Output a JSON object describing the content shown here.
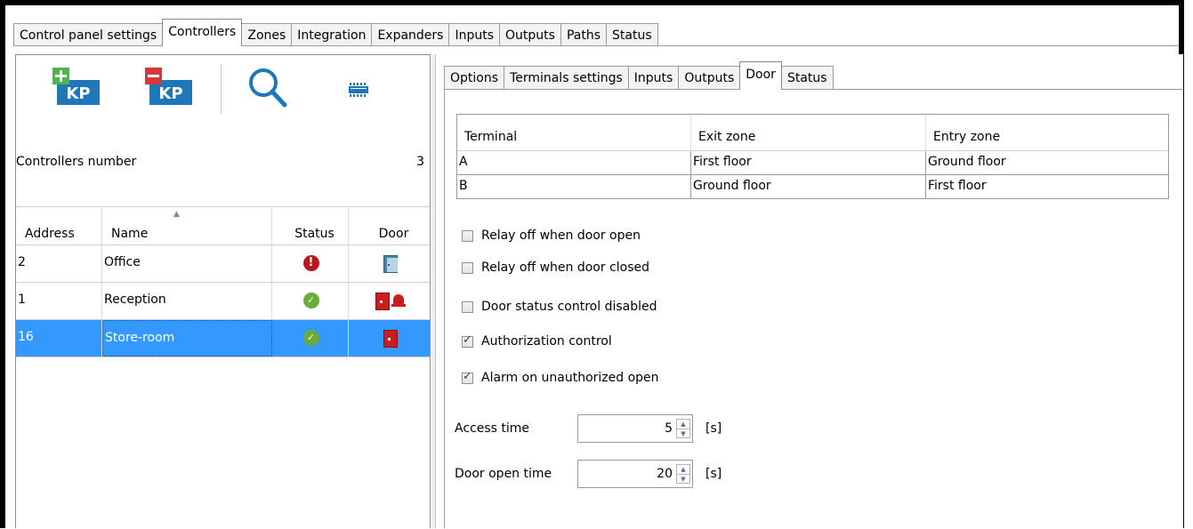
{
  "main_tabs": [
    "Control panel settings",
    "Controllers",
    "Zones",
    "Integration",
    "Expanders",
    "Inputs",
    "Outputs",
    "Paths",
    "Status"
  ],
  "main_active_tab": "Controllers",
  "toolbar": {
    "add_icon_text": "KP",
    "remove_icon_text": "KP"
  },
  "controllers_number": {
    "label": "Controllers number",
    "value": "3"
  },
  "controllers_table": {
    "headers": [
      "Address",
      "Name",
      "Status",
      "Door"
    ],
    "rows": [
      {
        "address": "2",
        "name": "Office",
        "status": "error",
        "door": "closed"
      },
      {
        "address": "1",
        "name": "Reception",
        "status": "ok",
        "door": "open-alarm"
      },
      {
        "address": "16",
        "name": "Store-room",
        "status": "ok",
        "door": "open",
        "selected": true
      }
    ]
  },
  "detail_tabs": [
    "Options",
    "Terminals settings",
    "Inputs",
    "Outputs",
    "Door",
    "Status"
  ],
  "detail_active_tab": "Door",
  "terminals_table": {
    "headers": [
      "Terminal",
      "Exit zone",
      "Entry zone"
    ],
    "rows": [
      [
        "A",
        "First floor",
        "Ground floor"
      ],
      [
        "B",
        "Ground floor",
        "First floor"
      ]
    ]
  },
  "options": [
    {
      "label": "Relay off when door open",
      "checked": false
    },
    {
      "label": "Relay off when door closed",
      "checked": false
    },
    {
      "label": "Door status control disabled",
      "checked": false
    },
    {
      "label": "Authorization control",
      "checked": true
    },
    {
      "label": "Alarm on unauthorized open",
      "checked": true
    }
  ],
  "access_time": {
    "label": "Access time",
    "value": "5",
    "unit": "[s]"
  },
  "door_open_time": {
    "label": "Door open time",
    "value": "20",
    "unit": "[s]"
  },
  "colors": {
    "selection": "#3399ff",
    "kp_blue": "#1e77b8",
    "add_green": "#4cb74a",
    "remove_red": "#d9363a",
    "error_red": "#c0141c",
    "ok_green": "#6aab3a"
  }
}
